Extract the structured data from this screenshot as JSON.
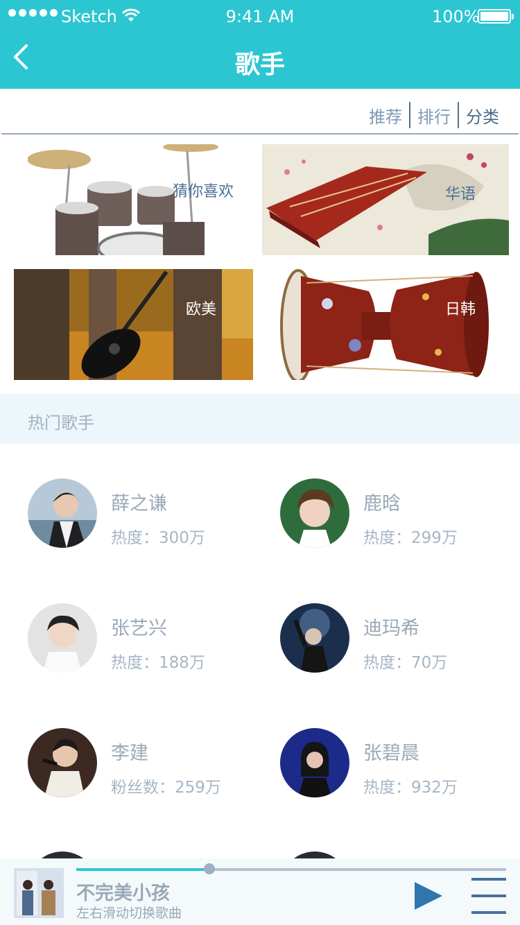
{
  "status": {
    "carrier": "Sketch",
    "time": "9:41 AM",
    "battery": "100%"
  },
  "header": {
    "title": "歌手"
  },
  "tabs": [
    "推荐",
    "排行",
    "分类"
  ],
  "categories": [
    "猜你喜欢",
    "华语",
    "欧美",
    "日韩"
  ],
  "hot": {
    "title": "热门歌手",
    "singers": [
      {
        "name": "薛之谦",
        "heat": "热度：300万"
      },
      {
        "name": "鹿晗",
        "heat": "热度：299万"
      },
      {
        "name": "张艺兴",
        "heat": "热度：188万"
      },
      {
        "name": "迪玛希",
        "heat": "热度：70万"
      },
      {
        "name": "李建",
        "heat": "粉丝数：259万"
      },
      {
        "name": "张碧晨",
        "heat": "热度：932万"
      }
    ]
  },
  "player": {
    "song": "不完美小孩",
    "hint": "左右滑动切换歌曲",
    "progress": 0.31
  },
  "icons": {
    "back": "chevron-left-icon",
    "wifi": "wifi-icon",
    "battery": "battery-icon",
    "play": "play-icon",
    "menu": "menu-icon"
  },
  "colors": {
    "header": "#2cc6d3",
    "accent": "#2cc6d3",
    "text_muted": "#9aa9b8",
    "playButton": "#2f76ae"
  }
}
